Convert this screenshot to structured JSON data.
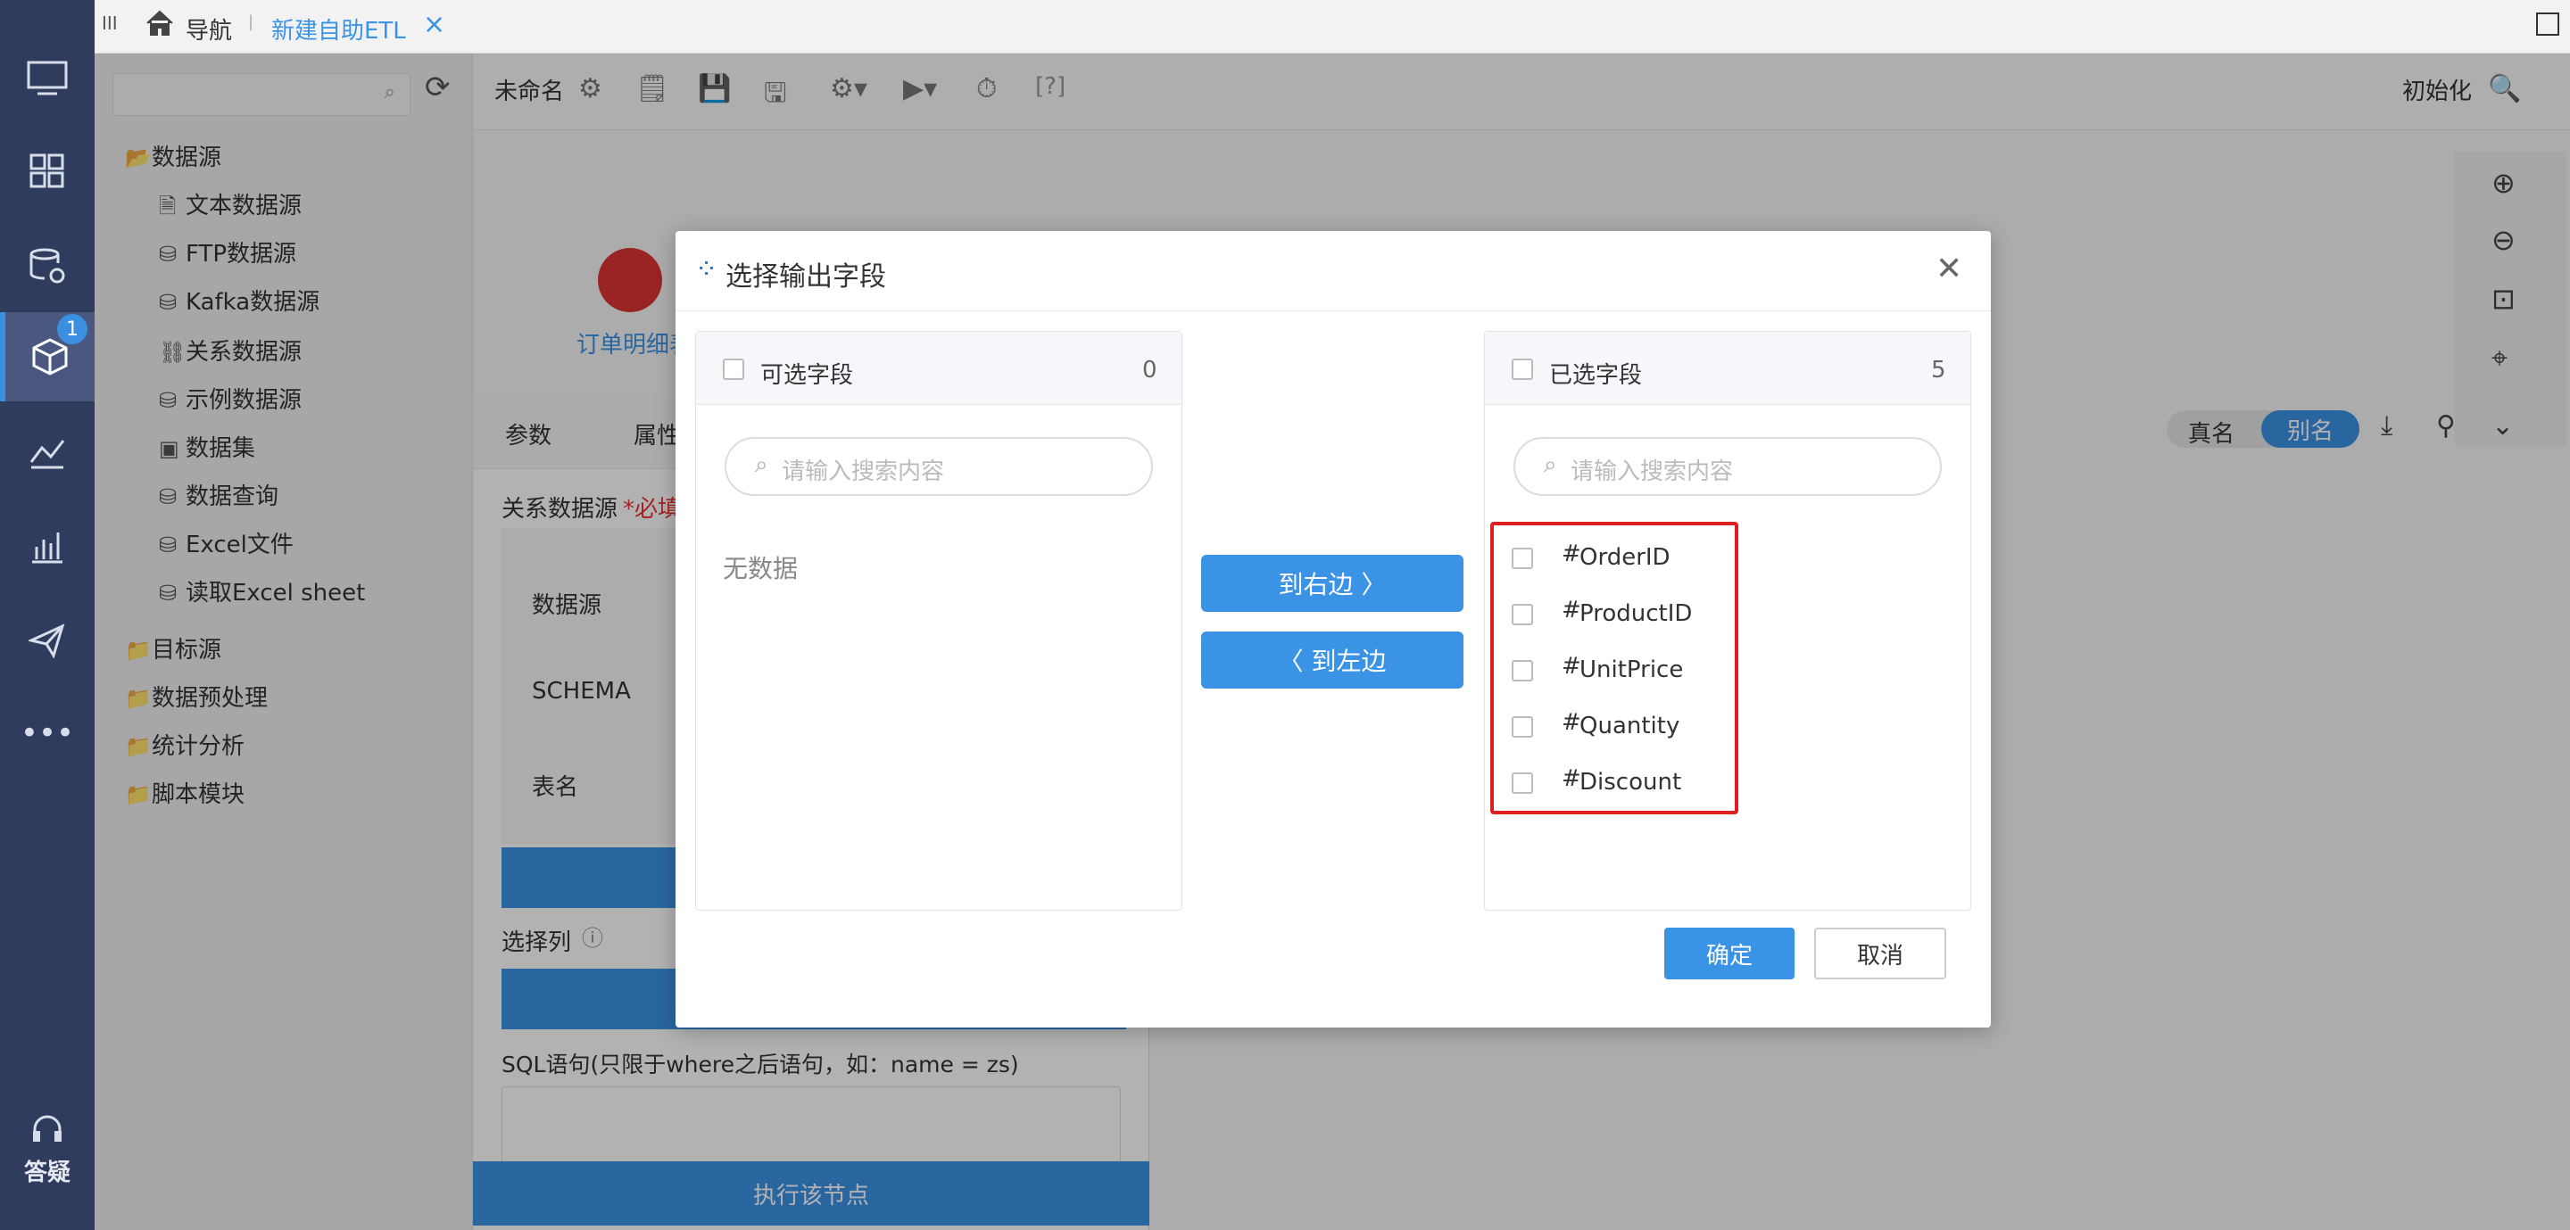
{
  "topbar": {
    "menu_icon": "III",
    "nav": "导航",
    "tab": "新建自助ETL",
    "close": "×"
  },
  "sidebar": {
    "help_label": "答疑",
    "badge": "1"
  },
  "tree": {
    "groups": [
      {
        "label": "数据源"
      },
      {
        "label": "目标源"
      },
      {
        "label": "数据预处理"
      },
      {
        "label": "统计分析"
      },
      {
        "label": "脚本模块"
      }
    ],
    "items": [
      {
        "label": "文本数据源"
      },
      {
        "label": "FTP数据源"
      },
      {
        "label": "Kafka数据源"
      },
      {
        "label": "关系数据源"
      },
      {
        "label": "示例数据源"
      },
      {
        "label": "数据集"
      },
      {
        "label": "数据查询"
      },
      {
        "label": "Excel文件"
      },
      {
        "label": "读取Excel sheet"
      }
    ]
  },
  "toolbar": {
    "name": "未命名",
    "init": "初始化",
    "help": "[?]"
  },
  "canvas": {
    "node_label": "订单明细表"
  },
  "params": {
    "tab1": "参数",
    "tab2": "属性",
    "source_label": "关系数据源",
    "required": "*必填",
    "f_source": "数据源",
    "f_schema": "SCHEMA",
    "f_table": "表名",
    "select_cols": "选择列",
    "sql_label": "SQL语句(只限于where之后语句，如：name = zs)",
    "exec": "执行该节点"
  },
  "right": {
    "real": "真名",
    "alias": "别名"
  },
  "dialog": {
    "title": "选择输出字段",
    "left": {
      "title": "可选字段",
      "count": "0",
      "placeholder": "请输入搜索内容",
      "empty": "无数据"
    },
    "right": {
      "title": "已选字段",
      "count": "5",
      "placeholder": "请输入搜索内容",
      "fields": [
        {
          "hash": "#",
          "name": "OrderID"
        },
        {
          "hash": "#",
          "name": "ProductID"
        },
        {
          "hash": "#",
          "name": "UnitPrice"
        },
        {
          "hash": "#",
          "name": "Quantity"
        },
        {
          "hash": "#",
          "name": "Discount"
        }
      ]
    },
    "to_right": "到右边 〉",
    "to_left": "〈 到左边",
    "ok": "确定",
    "cancel": "取消"
  },
  "colors": {
    "accent": "#3b93e6",
    "sidebar": "#2f3c5e",
    "highlight": "#e02020"
  }
}
